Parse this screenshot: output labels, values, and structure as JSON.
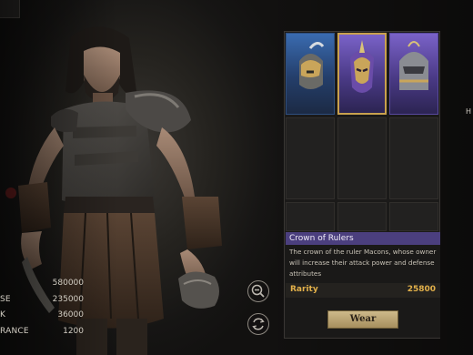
{
  "stats": [
    {
      "label": "",
      "value": "580000"
    },
    {
      "label": "SE",
      "value": "235000"
    },
    {
      "label": "K",
      "value": "36000"
    },
    {
      "label": "RANCE",
      "value": "1200"
    }
  ],
  "inventory": {
    "slots": [
      {
        "item": "blue-helmet-icon",
        "rarity_color": "#3a6bb0"
      },
      {
        "item": "purple-mask-helmet-icon",
        "rarity_color": "#7a62c8",
        "selected": true
      },
      {
        "item": "purple-knight-helmet-icon",
        "rarity_color": "#7a62c8"
      }
    ]
  },
  "item_info": {
    "name": "Crown of Rulers",
    "description": "The crown of the ruler Macons, whose owner will increase their attack power and defense attributes",
    "rarity_label": "Rarity",
    "rarity_value": "25800",
    "wear_label": "Wear"
  },
  "right_edge_text": "H",
  "colors": {
    "accent_gold": "#e2b04a",
    "title_bar": "#4b3f7e"
  }
}
